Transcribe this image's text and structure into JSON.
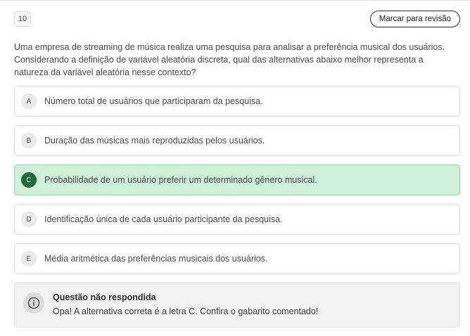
{
  "question": {
    "number": "10",
    "review_label": "Marcar para revisão",
    "statement": "Uma empresa de streaming de música realiza uma pesquisa para analisar a preferência musical dos usuários. Considerando a definição de variável aleatória discreta, qual das alternativas abaixo melhor representa a natureza da variável aleatória nesse contexto?"
  },
  "options": [
    {
      "letter": "A",
      "text": "Número total de usuários que participaram da pesquisa.",
      "state": "default"
    },
    {
      "letter": "B",
      "text": "Duração das músicas mais reproduzidas pelos usuários.",
      "state": "default"
    },
    {
      "letter": "C",
      "text": "Probabilidade de um usuário preferir um determinado gênero musical.",
      "state": "correct"
    },
    {
      "letter": "D",
      "text": "Identificação única de cada usuário participante da pesquisa.",
      "state": "default"
    },
    {
      "letter": "E",
      "text": "Média aritmética das preferências musicais dos usuários.",
      "state": "default"
    }
  ],
  "feedback": {
    "icon": "info-icon",
    "title": "Questão não respondida",
    "message": "Opa! A alternativa correta é a letra C. Confira o gabarito comentado!"
  },
  "colors": {
    "correct_bg": "#cff0d8",
    "correct_border": "#8fd3a2",
    "correct_badge": "#1e6b3a"
  }
}
